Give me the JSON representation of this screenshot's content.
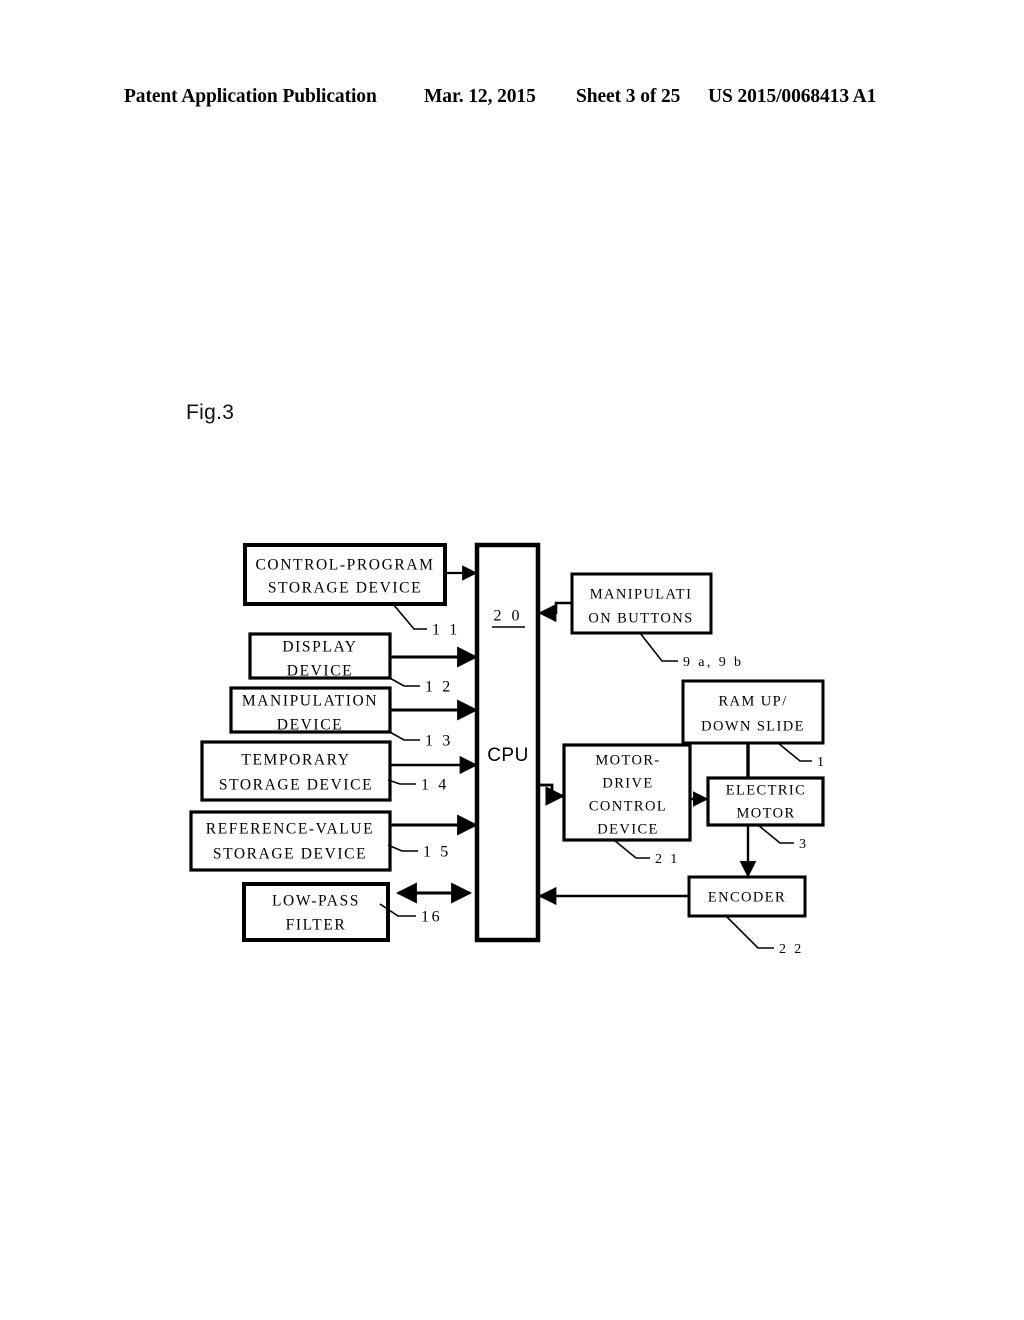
{
  "header": {
    "publication": "Patent Application Publication",
    "date": "Mar. 12, 2015",
    "sheet": "Sheet 3 of 25",
    "number": "US 2015/0068413 A1"
  },
  "figure": {
    "label": "Fig.3"
  },
  "diagram": {
    "title": "Fig.3",
    "type": "block-diagram",
    "boxes": {
      "control_program_storage": {
        "line1": "CONTROL-PROGRAM",
        "line2": "STORAGE DEVICE",
        "ref": "1 1"
      },
      "display_device": {
        "line1": "DISPLAY",
        "line2": "DEVICE",
        "ref": "1 2"
      },
      "manipulation_device": {
        "line1": "MANIPULATION",
        "line2": "DEVICE",
        "ref": "1 3"
      },
      "temporary_storage": {
        "line1": "TEMPORARY",
        "line2": "STORAGE DEVICE",
        "ref": "1 4"
      },
      "reference_value_storage": {
        "line1": "REFERENCE-VALUE",
        "line2": "STORAGE DEVICE",
        "ref": "1 5"
      },
      "low_pass_filter": {
        "line1": "LOW-PASS",
        "line2": "FILTER",
        "ref": "16"
      },
      "cpu": {
        "label": "CPU",
        "ref": "2 0"
      },
      "manipulation_buttons": {
        "line1": "MANIPULATI",
        "line2": "ON BUTTONS",
        "ref": "9 a,  9 b"
      },
      "ram_up_down_slide": {
        "line1": "RAM UP/",
        "line2": "DOWN SLIDE",
        "ref": "1"
      },
      "motor_drive_control": {
        "line1": "MOTOR-",
        "line2": "DRIVE",
        "line3": "CONTROL",
        "line4": "DEVICE",
        "ref": "2 1"
      },
      "electric_motor": {
        "line1": "ELECTRIC",
        "line2": "MOTOR",
        "ref": "3"
      },
      "encoder": {
        "line1": "ENCODER",
        "ref": "2 2"
      }
    },
    "connections": [
      {
        "from": "control_program_storage",
        "to": "cpu",
        "direction": "to-cpu"
      },
      {
        "from": "display_device",
        "to": "cpu",
        "direction": "to-cpu"
      },
      {
        "from": "manipulation_device",
        "to": "cpu",
        "direction": "to-cpu"
      },
      {
        "from": "temporary_storage",
        "to": "cpu",
        "direction": "to-cpu"
      },
      {
        "from": "reference_value_storage",
        "to": "cpu",
        "direction": "to-cpu"
      },
      {
        "from": "low_pass_filter",
        "to": "cpu",
        "direction": "bidirectional"
      },
      {
        "from": "manipulation_buttons",
        "to": "cpu",
        "direction": "to-cpu"
      },
      {
        "from": "cpu",
        "to": "motor_drive_control",
        "direction": "from-cpu"
      },
      {
        "from": "motor_drive_control",
        "to": "electric_motor",
        "direction": "forward"
      },
      {
        "from": "ram_up_down_slide",
        "to": "electric_motor",
        "direction": "link"
      },
      {
        "from": "electric_motor",
        "to": "encoder",
        "direction": "forward"
      },
      {
        "from": "encoder",
        "to": "cpu",
        "direction": "to-cpu"
      }
    ]
  }
}
